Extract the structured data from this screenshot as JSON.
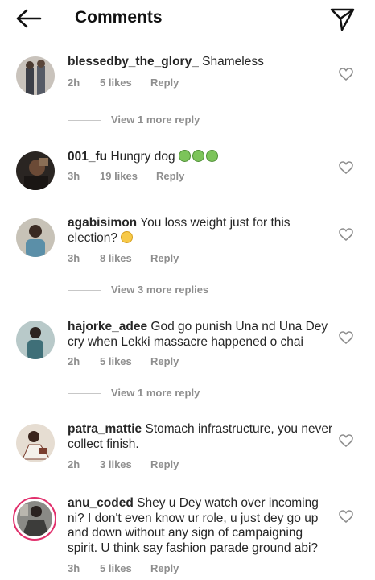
{
  "header": {
    "title": "Comments",
    "back_icon": "arrow-left-icon",
    "send_icon": "paper-plane-icon"
  },
  "comments": [
    {
      "username": "blessedby_the_glory_",
      "text": "Shameless",
      "time": "2h",
      "likes": "5 likes",
      "reply": "Reply",
      "more": "View 1 more reply",
      "avatar_colors": [
        "#6b6f7a",
        "#c9c3bc"
      ]
    },
    {
      "username": "001_fu",
      "text": "Hungry dog",
      "emoji": "nauseated-face",
      "time": "3h",
      "likes": "19 likes",
      "reply": "Reply",
      "avatar_colors": [
        "#2a2522",
        "#8a6e55"
      ]
    },
    {
      "username": "agabisimon",
      "text": "You loss weight just for this election?",
      "emoji": "tears-of-joy",
      "time": "3h",
      "likes": "8 likes",
      "reply": "Reply",
      "more": "View 3 more replies",
      "avatar_colors": [
        "#5b8fa8",
        "#c7c2b7"
      ]
    },
    {
      "username": "hajorke_adee",
      "text": "God go punish Una nd Una Dey cry when Lekki massacre happened o chai",
      "time": "2h",
      "likes": "5 likes",
      "reply": "Reply",
      "more": "View 1 more reply",
      "avatar_colors": [
        "#7aa0a4",
        "#b8c9c9"
      ]
    },
    {
      "username": "patra_mattie",
      "text": "Stomach infrastructure, you never collect finish.",
      "time": "2h",
      "likes": "3 likes",
      "reply": "Reply",
      "avatar_colors": [
        "#d8c7b8",
        "#7a3e2f"
      ]
    },
    {
      "username": "anu_coded",
      "text": "Shey u Dey watch over incoming ni? I don't even know ur role, u just dey go up and down without any sign of campaigning spirit. U think say fashion parade ground abi?",
      "time": "3h",
      "likes": "5 likes",
      "reply": "Reply",
      "avatar_colors": [
        "#8a8a86",
        "#3c3c3a"
      ]
    }
  ],
  "colors": {
    "text": "#262626",
    "meta": "#8e8e8e",
    "story_ring": "#e1306c"
  }
}
